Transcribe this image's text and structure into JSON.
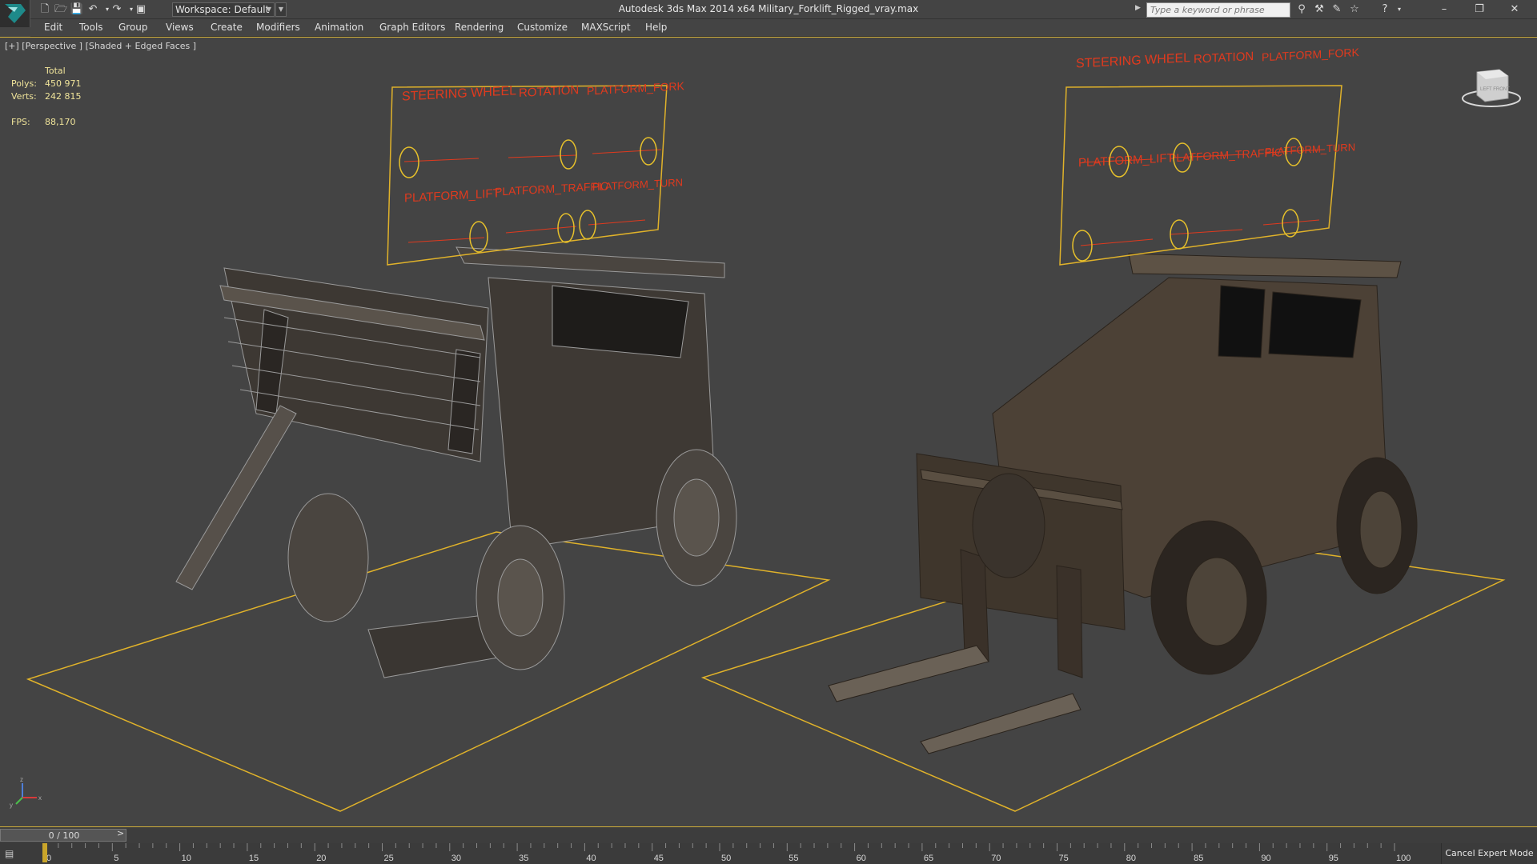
{
  "app": {
    "window_title": "Autodesk 3ds Max  2014 x64     Military_Forklift_Rigged_vray.max",
    "workspace_label": "Workspace: Default",
    "search_placeholder": "Type a keyword or phrase",
    "icons": [
      "new-file-icon",
      "open-file-icon",
      "save-icon",
      "undo-icon",
      "redo-icon",
      "project-icon",
      "binoculars-icon",
      "tools-icon",
      "star-icon",
      "help-icon"
    ]
  },
  "window_controls": {
    "minimize": "–",
    "restore": "❐",
    "close": "✕"
  },
  "menu": {
    "items": [
      "Edit",
      "Tools",
      "Group",
      "Views",
      "Create",
      "Modifiers",
      "Animation",
      "Graph Editors",
      "Rendering",
      "Customize",
      "MAXScript",
      "Help"
    ]
  },
  "viewport": {
    "label": "[+] [Perspective ] [Shaded + Edged Faces ]",
    "stats": {
      "header": "Total",
      "polys_label": "Polys:",
      "polys_value": "450 971",
      "verts_label": "Verts:",
      "verts_value": "242 815",
      "fps_label": "FPS:",
      "fps_value": "88,170"
    },
    "rig_panel_labels": [
      "STEERING WHEEL",
      "ROTATION",
      "PLATFORM_FORK",
      "PLATFORM_LIFT",
      "PLATFORM_TRAFFIC",
      "PLATFORM_TURN"
    ],
    "viewcube_face": "LEFT FRONT",
    "axis_labels": {
      "x": "x",
      "y": "y",
      "z": "z"
    },
    "colors": {
      "viewport_bg": "#444444",
      "selection_gold": "#e0b22a",
      "rig_label_red": "#e03a1e",
      "model_brown": "#4a3f33"
    }
  },
  "timeline": {
    "slider_label": "0 / 100",
    "prev": "<",
    "next": ">",
    "current_frame": 0,
    "ticks": [
      "0",
      "5",
      "10",
      "15",
      "20",
      "25",
      "30",
      "35",
      "40",
      "45",
      "50",
      "55",
      "60",
      "65",
      "70",
      "75",
      "80",
      "85",
      "90",
      "95",
      "100"
    ]
  },
  "status": {
    "expert_mode_button": "Cancel Expert Mode"
  }
}
